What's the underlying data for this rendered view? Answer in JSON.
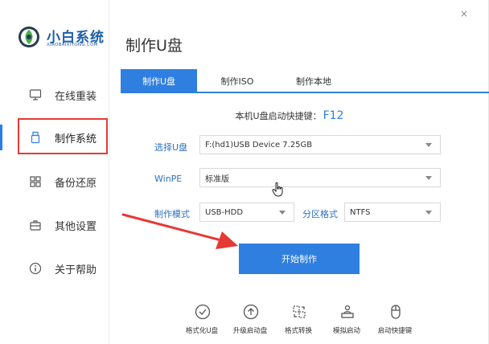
{
  "app": {
    "title": "小白系统",
    "subtitle": "XIAOBAIXITONG.COM",
    "page_title": "制作U盘",
    "window_controls": {
      "close": "×"
    }
  },
  "sidebar": {
    "items": [
      {
        "label": "在线重装",
        "icon": "monitor-icon"
      },
      {
        "label": "制作系统",
        "icon": "usb-icon",
        "active": true
      },
      {
        "label": "备份还原",
        "icon": "grid-icon"
      },
      {
        "label": "其他设置",
        "icon": "briefcase-icon"
      },
      {
        "label": "关于帮助",
        "icon": "info-icon"
      }
    ]
  },
  "tabs": [
    {
      "label": "制作U盘",
      "active": true
    },
    {
      "label": "制作ISO"
    },
    {
      "label": "制作本地"
    }
  ],
  "hint": {
    "text": "本机U盘启动快捷键：",
    "key": "F12"
  },
  "form": {
    "usb_label": "选择U盘",
    "usb_value": "F:(hd1)USB Device 7.25GB",
    "winpe_label": "WinPE",
    "winpe_value": "标准版",
    "mode_label": "制作模式",
    "mode_value": "USB-HDD",
    "partition_label": "分区格式",
    "partition_value": "NTFS"
  },
  "start_button": "开始制作",
  "tools": [
    {
      "label": "格式化U盘",
      "icon": "check-circle-icon"
    },
    {
      "label": "升级启动盘",
      "icon": "upload-circle-icon"
    },
    {
      "label": "格式转换",
      "icon": "convert-icon"
    },
    {
      "label": "模拟启动",
      "icon": "person-desk-icon"
    },
    {
      "label": "启动快捷键",
      "icon": "mouse-icon"
    }
  ],
  "colors": {
    "accent": "#2f7fe0",
    "highlight": "#e53935",
    "brand": "#1d5fa8"
  }
}
